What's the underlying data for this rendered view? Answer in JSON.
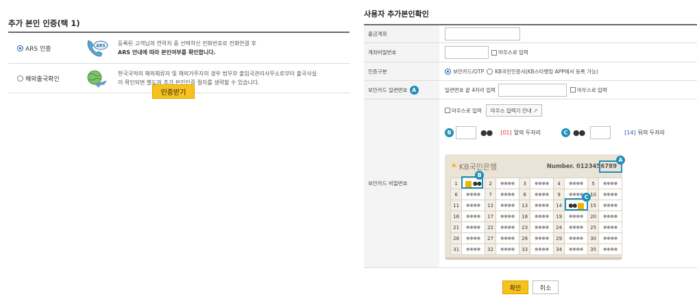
{
  "left": {
    "title": "추가 본인 인증(택 1)",
    "options": [
      {
        "label": "ARS 인증",
        "selected": true,
        "icon": "phone-ars-icon",
        "desc_line1": "등록된 고객님의 연락처 중 선택하신 전화번호로 전화연결 후",
        "desc_line2": "ARS 안내에 따라 본인여부를 확인합니다."
      },
      {
        "label": "해외출국확인",
        "selected": false,
        "icon": "globe-plane-icon",
        "desc_line1": "한국국적의 해외체류자 및 해외거주자의 경우 법무부 출입국관리사무소로부터 출국사실",
        "desc_line2": "이 확인되면 별도의 추가 본인인증 절차를 생략할 수 있습니다."
      }
    ],
    "cert_button": "인증받기"
  },
  "right": {
    "title": "사용자 추가본인확인",
    "rows": {
      "account_label": "출금계좌",
      "password_label": "계좌비밀번호",
      "mouse_input": "마우스로 입력",
      "auth_type_label": "인증구분",
      "auth_option1": "보안카드/OTP",
      "auth_option2": "KB국민인증서(KB스타뱅킹 APP에서 등록 가능)",
      "serial_label": "보안카드 일련번호",
      "serial_badge": "A",
      "serial_hint": "일련번호 끝 4자리 입력",
      "card_pw_label": "보안카드 비밀번호",
      "mouse_guide_button": "마우스 입력기 안내",
      "b_badge": "B",
      "c_badge": "C",
      "b_num": "[01]",
      "b_text": "앞의 두자리",
      "c_num": "[14]",
      "c_text": "뒤의 두자리",
      "dots": "●●"
    },
    "card": {
      "bank": "KB국민은행",
      "number_label": "Number.",
      "number": "0123456789",
      "secret_mask": "●●●●",
      "grid": [
        [
          1,
          2,
          3,
          4,
          5
        ],
        [
          6,
          7,
          8,
          9,
          10
        ],
        [
          11,
          12,
          13,
          14,
          15
        ],
        [
          16,
          17,
          18,
          19,
          20
        ],
        [
          21,
          22,
          23,
          24,
          25
        ],
        [
          26,
          27,
          28,
          29,
          30
        ],
        [
          31,
          32,
          33,
          34,
          35
        ]
      ]
    },
    "confirm_button": "확인",
    "cancel_button": "취소"
  }
}
